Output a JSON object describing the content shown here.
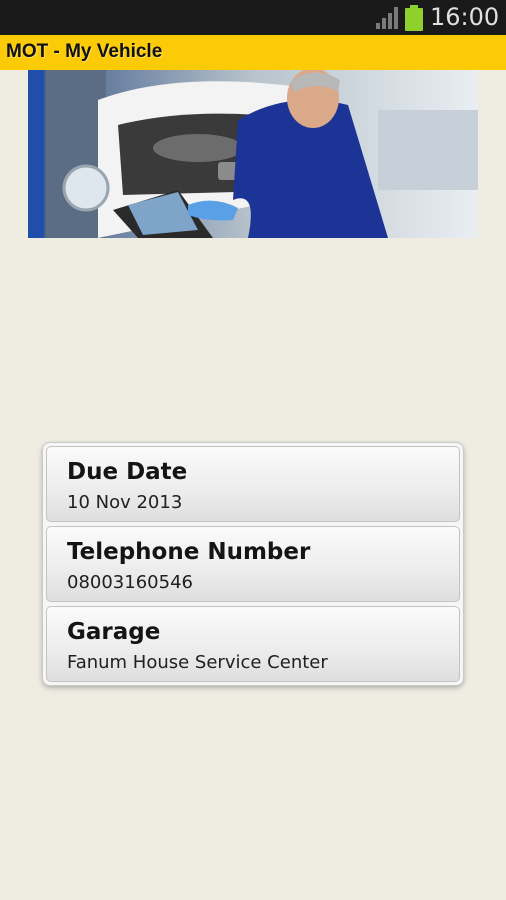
{
  "status_bar": {
    "time": "16:00",
    "icons": [
      "signal-icon",
      "battery-icon"
    ],
    "battery_color": "#8ed12c"
  },
  "app_bar": {
    "title": "MOT - My Vehicle",
    "background": "#fccb07"
  },
  "hero_image": {
    "icon": "mechanic-photo"
  },
  "details": [
    {
      "label": "Due Date",
      "value": "10 Nov 2013"
    },
    {
      "label": "Telephone Number",
      "value": "08003160546"
    },
    {
      "label": "Garage",
      "value": "Fanum House Service Center"
    }
  ]
}
